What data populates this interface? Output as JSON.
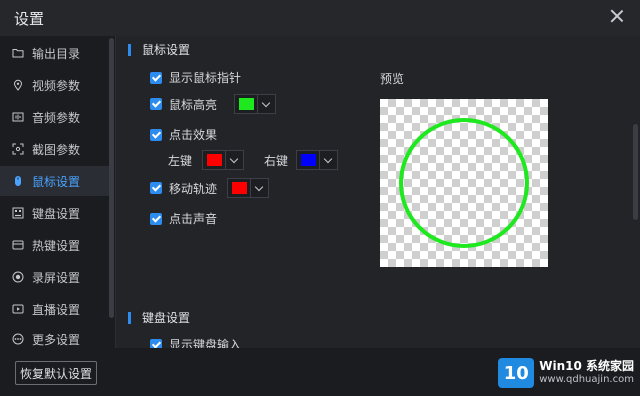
{
  "window": {
    "title": "设置"
  },
  "sidebar": {
    "items": [
      {
        "label": "输出目录",
        "icon": "folder-icon"
      },
      {
        "label": "视频参数",
        "icon": "location-pin-icon"
      },
      {
        "label": "音频参数",
        "icon": "audio-icon"
      },
      {
        "label": "截图参数",
        "icon": "screenshot-icon"
      },
      {
        "label": "鼠标设置",
        "icon": "mouse-icon",
        "active": true
      },
      {
        "label": "键盘设置",
        "icon": "keyboard-icon"
      },
      {
        "label": "热键设置",
        "icon": "hotkey-icon"
      },
      {
        "label": "录屏设置",
        "icon": "record-icon"
      },
      {
        "label": "直播设置",
        "icon": "live-icon"
      },
      {
        "label": "更多设置",
        "icon": "more-icon"
      }
    ]
  },
  "mouse": {
    "title": "鼠标设置",
    "show_pointer": "显示鼠标指针",
    "highlight": "鼠标高亮",
    "highlight_color": "#1ee81e",
    "click_effect": "点击效果",
    "left_key": "左键",
    "left_color": "#ff0000",
    "right_key": "右键",
    "right_color": "#0000ff",
    "trail": "移动轨迹",
    "trail_color": "#ff0000",
    "click_sound": "点击声音"
  },
  "preview": {
    "label": "预览",
    "ring_color": "#1ee81e"
  },
  "keyboard": {
    "title": "键盘设置",
    "show_input": "显示键盘输入"
  },
  "footer": {
    "reset_label": "恢复默认设置"
  },
  "watermark": {
    "logo": "10",
    "line1": "Win10 系统家园",
    "line2": "www.qdhuajin.com"
  },
  "colors": {
    "accent": "#2d8cf0"
  }
}
